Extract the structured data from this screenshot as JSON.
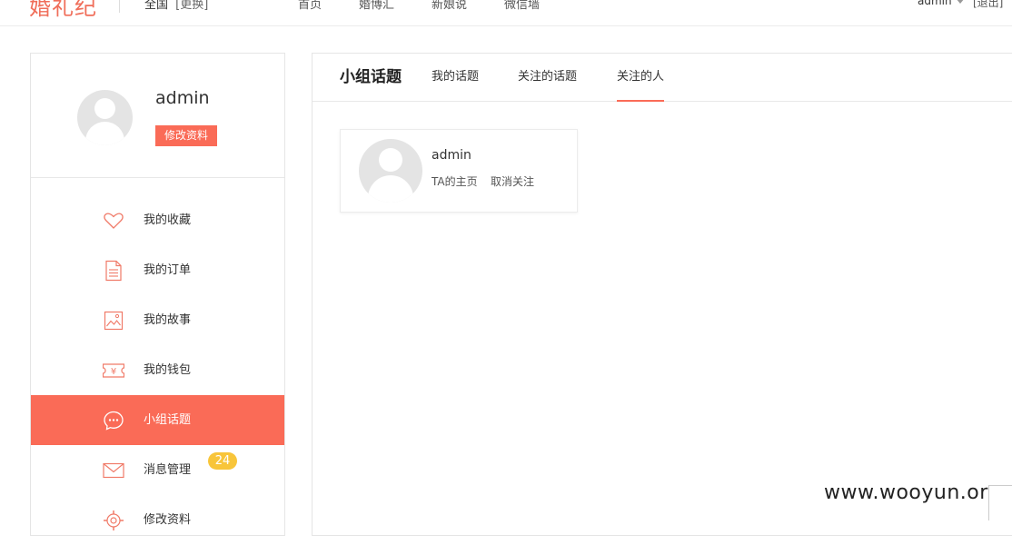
{
  "colors": {
    "accent": "#fa6b57",
    "badge": "#f8c53a"
  },
  "header": {
    "logo": "婚礼纪",
    "city": "全国",
    "city_switch": "[更换]",
    "nav": [
      "首页",
      "婚博汇",
      "新娘说",
      "微信墙"
    ],
    "username": "admin",
    "logout": "[退出]"
  },
  "profile": {
    "name": "admin",
    "edit_label": "修改资料"
  },
  "menu": [
    {
      "label": "我的收藏",
      "icon": "heart-icon"
    },
    {
      "label": "我的订单",
      "icon": "document-icon"
    },
    {
      "label": "我的故事",
      "icon": "photo-icon"
    },
    {
      "label": "我的钱包",
      "icon": "wallet-icon"
    },
    {
      "label": "小组话题",
      "icon": "chat-bubble-icon",
      "active": true
    },
    {
      "label": "消息管理",
      "icon": "envelope-icon",
      "badge": "24"
    },
    {
      "label": "修改资料",
      "icon": "gear-icon"
    }
  ],
  "main": {
    "section_title": "小组话题",
    "tabs": [
      "我的话题",
      "关注的话题",
      "关注的人"
    ],
    "active_tab": "关注的人",
    "following": [
      {
        "name": "admin",
        "homepage_link": "TA的主页",
        "unfollow_link": "取消关注"
      }
    ]
  },
  "watermark": "www.wooyun.org"
}
